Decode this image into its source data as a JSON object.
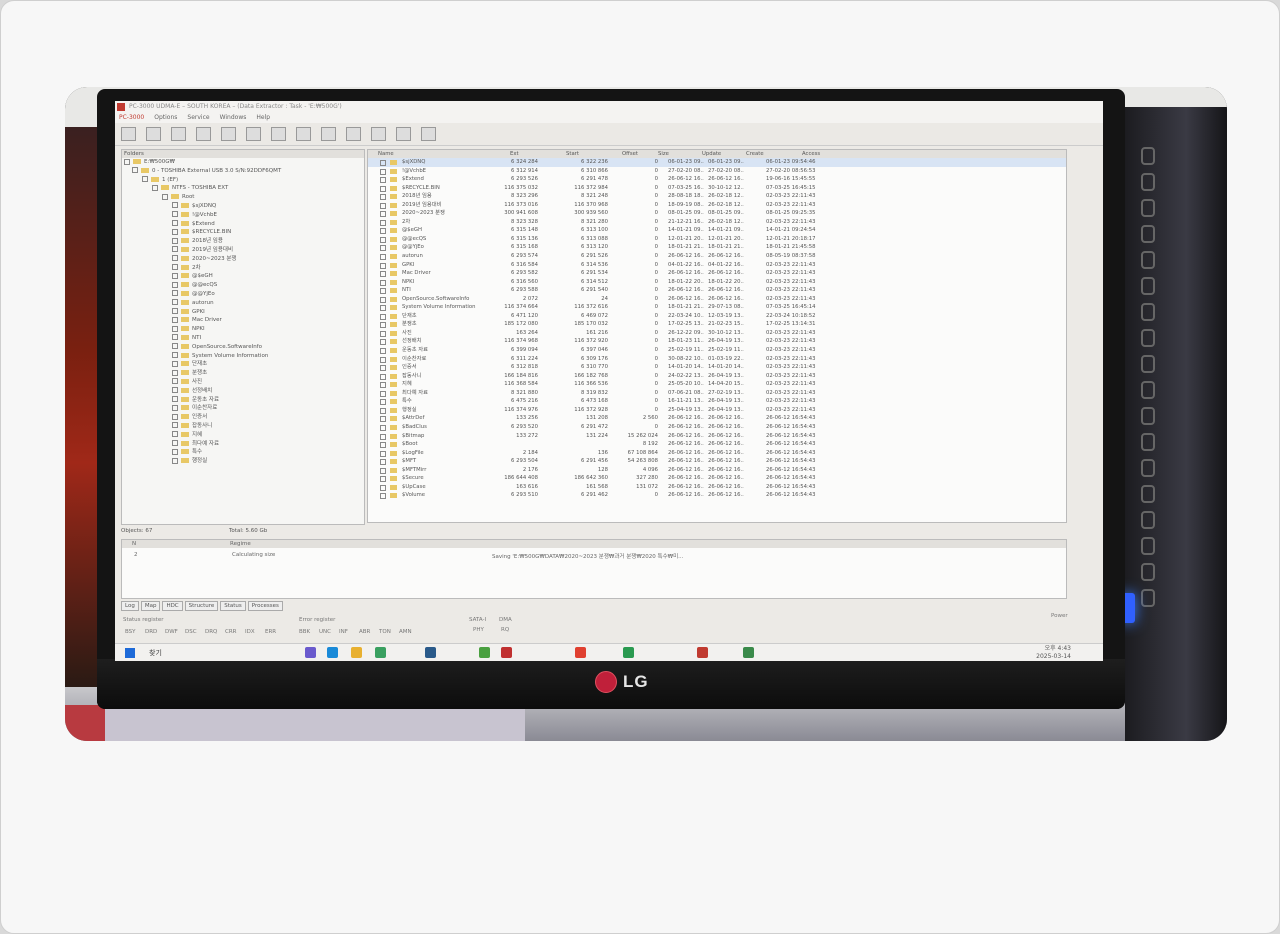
{
  "window": {
    "title": "PC-3000 UDMA-E – SOUTH KOREA – (Data Extractor : Task - 'E:₩500G')",
    "menu": [
      "PC-3000",
      "Options",
      "Service",
      "Windows",
      "Help"
    ]
  },
  "folders": {
    "header": "Folders",
    "tree": [
      "E:₩500G₩",
      "0 - TOSHIBA External USB 3.0 S/N:92DDF6QMT",
      "1 (EF)",
      "NTFS - TOSHIBA EXT",
      "Root",
      "$sjXDNQ",
      "!@VchbE",
      "$Extend",
      "$RECYCLE.BIN",
      "2018년 임용",
      "2019년 임용대비",
      "2020~2023 분쟁",
      "2차",
      "@$eGH",
      "@@ecQS",
      "@@YjEo",
      "autorun",
      "GPKI",
      "Mac Driver",
      "NPKI",
      "NTI",
      "OpenSource.SoftwareInfo",
      "System Volume Information",
      "단재초",
      "분쟁초",
      "사진",
      "선정배치",
      "운동초 자료",
      "이순찬자료",
      "인증서",
      "잡동사니",
      "지혜",
      "최다예 자료",
      "특수",
      "행정실"
    ],
    "objects": "Objects: 67",
    "total": "Total: 5.60 Gb"
  },
  "list": {
    "columns": [
      "Name",
      "Ext",
      "Start",
      "Offset",
      "Size",
      "Update",
      "Create",
      "Access"
    ],
    "rows": [
      [
        "$sjXDNQ",
        "6 324 284",
        "6 322 236",
        "0",
        "06-01-23 09..",
        "06-01-23 09..",
        "06-01-23 09:54:46"
      ],
      [
        "!@VchbE",
        "6 312 914",
        "6 310 866",
        "0",
        "27-02-20 08..",
        "27-02-20 08..",
        "27-02-20 08:56:53"
      ],
      [
        "$Extend",
        "6 293 526",
        "6 291 478",
        "0",
        "26-06-12 16..",
        "26-06-12 16..",
        "19-06-16 15:45:55"
      ],
      [
        "$RECYCLE.BIN",
        "116 375 032",
        "116 372 984",
        "0",
        "07-03-25 16..",
        "30-10-12 12..",
        "07-03-25 16:45:15"
      ],
      [
        "2018년 임용",
        "8 323 296",
        "8 321 248",
        "0",
        "28-08-18 18..",
        "26-02-18 12..",
        "02-03-23 22:11:43"
      ],
      [
        "2019년 임용대비",
        "116 373 016",
        "116 370 968",
        "0",
        "18-09-19 08..",
        "26-02-18 12..",
        "02-03-23 22:11:43"
      ],
      [
        "2020~2023 분쟁",
        "300 941 608",
        "300 939 560",
        "0",
        "08-01-25 09..",
        "08-01-25 09..",
        "08-01-25 09:25:35"
      ],
      [
        "2차",
        "8 323 328",
        "8 321 280",
        "0",
        "21-12-21 16..",
        "26-02-18 12..",
        "02-03-23 22:11:43"
      ],
      [
        "@$eGH",
        "6 315 148",
        "6 313 100",
        "0",
        "14-01-21 09..",
        "14-01-21 09..",
        "14-01-21 09:24:54"
      ],
      [
        "@@ecQS",
        "6 315 136",
        "6 313 088",
        "0",
        "12-01-21 20..",
        "12-01-21 20..",
        "12-01-21 20:18:17"
      ],
      [
        "@@YjEo",
        "6 315 168",
        "6 313 120",
        "0",
        "18-01-21 21..",
        "18-01-21 21..",
        "18-01-21 21:45:58"
      ],
      [
        "autorun",
        "6 293 574",
        "6 291 526",
        "0",
        "26-06-12 16..",
        "26-06-12 16..",
        "08-05-19 08:37:58"
      ],
      [
        "GPKI",
        "6 316 584",
        "6 314 536",
        "0",
        "04-01-22 16..",
        "04-01-22 16..",
        "02-03-23 22:11:43"
      ],
      [
        "Mac Driver",
        "6 293 582",
        "6 291 534",
        "0",
        "26-06-12 16..",
        "26-06-12 16..",
        "02-03-23 22:11:43"
      ],
      [
        "NPKI",
        "6 316 560",
        "6 314 512",
        "0",
        "18-01-22 20..",
        "18-01-22 20..",
        "02-03-23 22:11:43"
      ],
      [
        "NTI",
        "6 293 588",
        "6 291 540",
        "0",
        "26-06-12 16..",
        "26-06-12 16..",
        "02-03-23 22:11:43"
      ],
      [
        "OpenSource.SoftwareInfo",
        "2 072",
        "24",
        "0",
        "26-06-12 16..",
        "26-06-12 16..",
        "02-03-23 22:11:43"
      ],
      [
        "System Volume Information",
        "116 374 664",
        "116 372 616",
        "0",
        "18-01-21 21..",
        "29-07-13 08..",
        "07-03-25 16:45:14"
      ],
      [
        "단재초",
        "6 471 120",
        "6 469 072",
        "0",
        "22-03-24 10..",
        "12-03-19 13..",
        "22-03-24 10:18:52"
      ],
      [
        "분쟁초",
        "185 172 080",
        "185 170 032",
        "0",
        "17-02-25 13..",
        "21-02-23 15..",
        "17-02-25 13:14:31"
      ],
      [
        "사진",
        "163 264",
        "161 216",
        "0",
        "26-12-22 09..",
        "30-10-12 13..",
        "02-03-23 22:11:43"
      ],
      [
        "선정배치",
        "116 374 968",
        "116 372 920",
        "0",
        "18-01-23 11..",
        "26-04-19 13..",
        "02-03-23 22:11:43"
      ],
      [
        "운동초 자료",
        "6 399 094",
        "6 397 046",
        "0",
        "25-02-19 11..",
        "25-02-19 11..",
        "02-03-23 22:11:43"
      ],
      [
        "이순찬자료",
        "6 311 224",
        "6 309 176",
        "0",
        "30-08-22 10..",
        "01-03-19 22..",
        "02-03-23 22:11:43"
      ],
      [
        "인증서",
        "6 312 818",
        "6 310 770",
        "0",
        "14-01-20 14..",
        "14-01-20 14..",
        "02-03-23 22:11:43"
      ],
      [
        "잡동사니",
        "166 184 816",
        "166 182 768",
        "0",
        "24-02-22 13..",
        "26-04-19 13..",
        "02-03-23 22:11:43"
      ],
      [
        "지혜",
        "116 368 584",
        "116 366 536",
        "0",
        "25-05-20 10..",
        "14-04-20 15..",
        "02-03-23 22:11:43"
      ],
      [
        "최다예 자료",
        "8 321 880",
        "8 319 832",
        "0",
        "07-06-21 08..",
        "27-02-19 13..",
        "02-03-23 22:11:43"
      ],
      [
        "특수",
        "6 475 216",
        "6 473 168",
        "0",
        "16-11-21 13..",
        "26-04-19 13..",
        "02-03-23 22:11:43"
      ],
      [
        "행정실",
        "116 374 976",
        "116 372 928",
        "0",
        "25-04-19 13..",
        "26-04-19 13..",
        "02-03-23 22:11:43"
      ],
      [
        "$AttrDef",
        "133 256",
        "131 208",
        "2 560",
        "26-06-12 16..",
        "26-06-12 16..",
        "26-06-12 16:54:43"
      ],
      [
        "$BadClus",
        "6 293 520",
        "6 291 472",
        "0",
        "26-06-12 16..",
        "26-06-12 16..",
        "26-06-12 16:54:43"
      ],
      [
        "$Bitmap",
        "133 272",
        "131 224",
        "15 262 024",
        "26-06-12 16..",
        "26-06-12 16..",
        "26-06-12 16:54:43"
      ],
      [
        "$Boot",
        "",
        "",
        "8 192",
        "26-06-12 16..",
        "26-06-12 16..",
        "26-06-12 16:54:43"
      ],
      [
        "$LogFile",
        "2 184",
        "136",
        "67 108 864",
        "26-06-12 16..",
        "26-06-12 16..",
        "26-06-12 16:54:43"
      ],
      [
        "$MFT",
        "6 293 504",
        "6 291 456",
        "54 263 808",
        "26-06-12 16..",
        "26-06-12 16..",
        "26-06-12 16:54:43"
      ],
      [
        "$MFTMirr",
        "2 176",
        "128",
        "4 096",
        "26-06-12 16..",
        "26-06-12 16..",
        "26-06-12 16:54:43"
      ],
      [
        "$Secure",
        "186 644 408",
        "186 642 360",
        "327 280",
        "26-06-12 16..",
        "26-06-12 16..",
        "26-06-12 16:54:43"
      ],
      [
        "$UpCase",
        "163 616",
        "161 568",
        "131 072",
        "26-06-12 16..",
        "26-06-12 16..",
        "26-06-12 16:54:43"
      ],
      [
        "$Volume",
        "6 293 510",
        "6 291 462",
        "0",
        "26-06-12 16..",
        "26-06-12 16..",
        "26-06-12 16:54:43"
      ]
    ]
  },
  "log": {
    "col_n": "N",
    "col_regime": "Regime",
    "row_n": "2",
    "row_regime": "Calculating size",
    "saving": "Saving 'E:₩500G₩DATA₩2020~2023 분쟁₩과거 분쟁₩2020 특수₩미..."
  },
  "tabs": [
    "Log",
    "Map",
    "HDC",
    "Structure",
    "Status",
    "Processes"
  ],
  "registers": {
    "status": "Status register",
    "error": "Error register",
    "sata": "SATA-I",
    "dma": "DMA",
    "power": "Power",
    "status_bits": [
      "BSY",
      "DRD",
      "DWF",
      "DSC",
      "DRQ",
      "CRR",
      "IDX",
      "ERR"
    ],
    "error_bits": [
      "BBK",
      "UNC",
      "INF",
      "ABR",
      "TON",
      "AMN"
    ],
    "sata_bit": "PHY",
    "dma_bit": "RQ"
  },
  "taskbar": {
    "search": "찾기",
    "time": "오후 4:43",
    "date": "2025-03-14"
  },
  "monitor": {
    "brand": "LG"
  },
  "colors": {
    "accent": "#c03a30",
    "folder": "#e8c866",
    "selected": "#d8e4f4"
  }
}
